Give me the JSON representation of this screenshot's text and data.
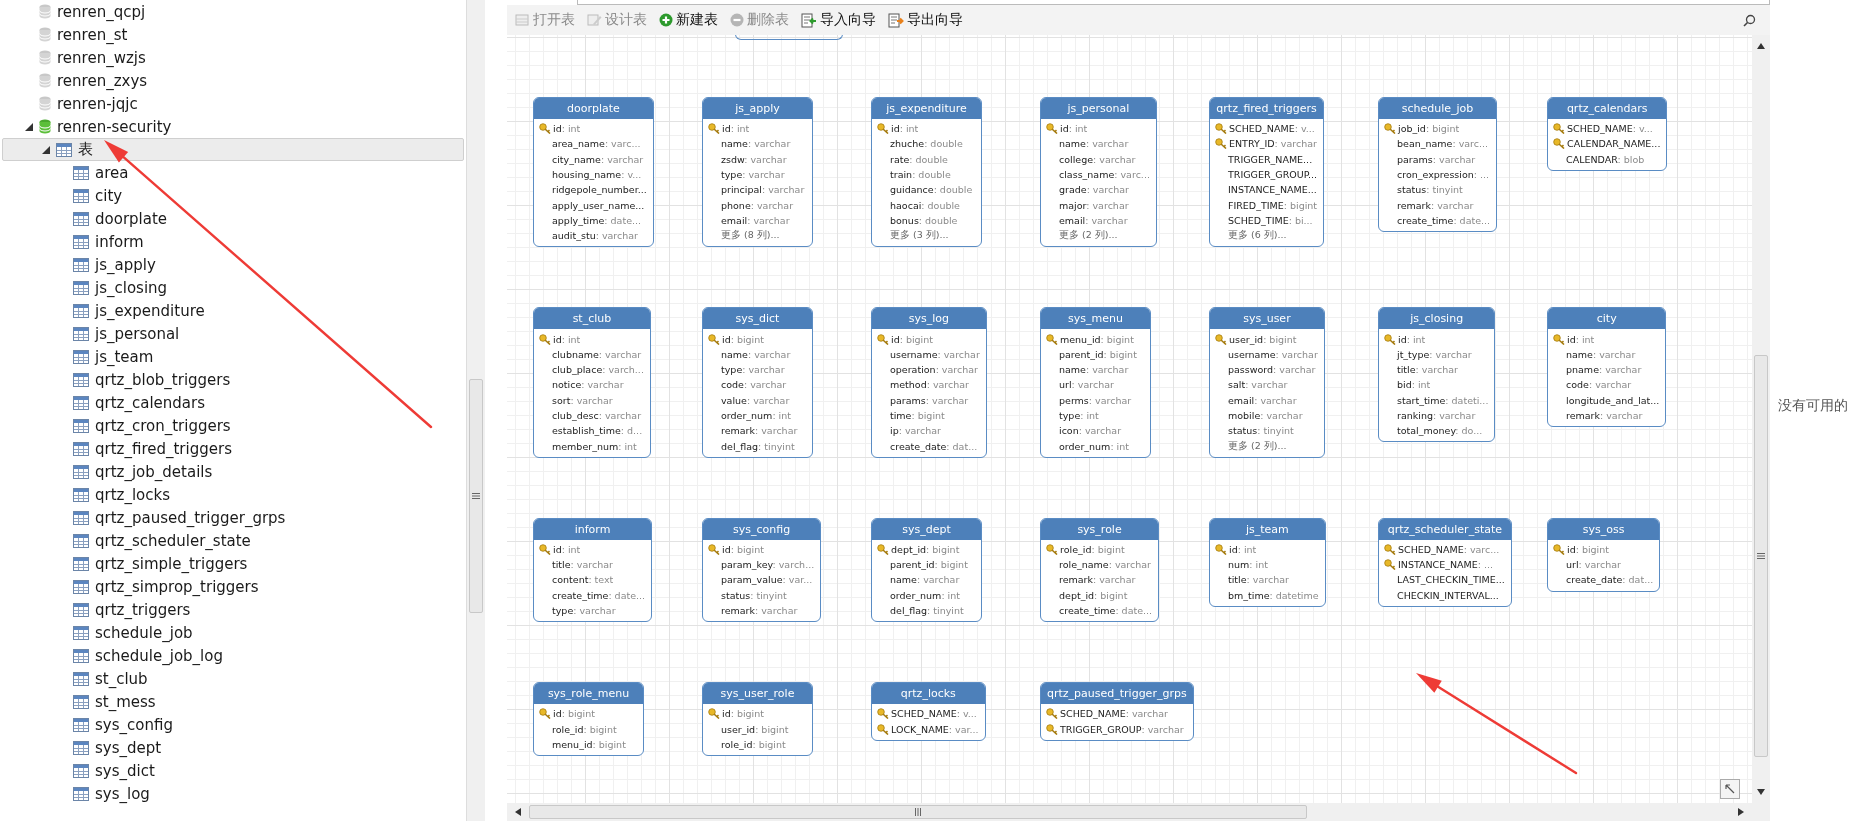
{
  "tree": [
    {
      "label": "renren_qcpj",
      "kind": "database",
      "selected": false
    },
    {
      "label": "renren_st",
      "kind": "database",
      "selected": false
    },
    {
      "label": "renren_wzjs",
      "kind": "database",
      "selected": false
    },
    {
      "label": "renren_zxys",
      "kind": "database",
      "selected": false
    },
    {
      "label": "renren-jqjc",
      "kind": "database",
      "selected": false
    },
    {
      "label": "renren-security",
      "kind": "database",
      "selected": false,
      "expanded": true,
      "children": [
        {
          "label": "表",
          "kind": "folder",
          "selected": true,
          "expanded": true,
          "children": [
            {
              "label": "area",
              "kind": "table",
              "selected": false
            },
            {
              "label": "city",
              "kind": "table",
              "selected": false
            },
            {
              "label": "doorplate",
              "kind": "table",
              "selected": false
            },
            {
              "label": "inform",
              "kind": "table",
              "selected": false
            },
            {
              "label": "js_apply",
              "kind": "table",
              "selected": false
            },
            {
              "label": "js_closing",
              "kind": "table",
              "selected": false
            },
            {
              "label": "js_expenditure",
              "kind": "table",
              "selected": false
            },
            {
              "label": "js_personal",
              "kind": "table",
              "selected": false
            },
            {
              "label": "js_team",
              "kind": "table",
              "selected": false
            },
            {
              "label": "qrtz_blob_triggers",
              "kind": "table",
              "selected": false
            },
            {
              "label": "qrtz_calendars",
              "kind": "table",
              "selected": false
            },
            {
              "label": "qrtz_cron_triggers",
              "kind": "table",
              "selected": false
            },
            {
              "label": "qrtz_fired_triggers",
              "kind": "table",
              "selected": false
            },
            {
              "label": "qrtz_job_details",
              "kind": "table",
              "selected": false
            },
            {
              "label": "qrtz_locks",
              "kind": "table",
              "selected": false
            },
            {
              "label": "qrtz_paused_trigger_grps",
              "kind": "table",
              "selected": false
            },
            {
              "label": "qrtz_scheduler_state",
              "kind": "table",
              "selected": false
            },
            {
              "label": "qrtz_simple_triggers",
              "kind": "table",
              "selected": false
            },
            {
              "label": "qrtz_simprop_triggers",
              "kind": "table",
              "selected": false
            },
            {
              "label": "qrtz_triggers",
              "kind": "table",
              "selected": false
            },
            {
              "label": "schedule_job",
              "kind": "table",
              "selected": false
            },
            {
              "label": "schedule_job_log",
              "kind": "table",
              "selected": false
            },
            {
              "label": "st_club",
              "kind": "table",
              "selected": false
            },
            {
              "label": "st_mess",
              "kind": "table",
              "selected": false
            },
            {
              "label": "sys_config",
              "kind": "table",
              "selected": false
            },
            {
              "label": "sys_dept",
              "kind": "table",
              "selected": false
            },
            {
              "label": "sys_dict",
              "kind": "table",
              "selected": false
            },
            {
              "label": "sys_log",
              "kind": "table",
              "selected": false
            }
          ]
        }
      ]
    }
  ],
  "toolbar": [
    {
      "label": "打开表",
      "kind": "open",
      "disabled": true
    },
    {
      "label": "设计表",
      "kind": "design",
      "disabled": true
    },
    {
      "label": "新建表",
      "kind": "new",
      "disabled": false
    },
    {
      "label": "删除表",
      "kind": "delete",
      "disabled": true
    },
    {
      "label": "导入向导",
      "kind": "import",
      "disabled": false
    },
    {
      "label": "导出向导",
      "kind": "export",
      "disabled": false
    }
  ],
  "diagram_rows": [
    [
      {
        "name": "doorplate",
        "fields": [
          {
            "kind": "key",
            "name": "id",
            "type": ": int"
          },
          {
            "kind": "column",
            "name": "area_name",
            "type": ": varc..."
          },
          {
            "kind": "column",
            "name": "city_name",
            "type": ": varchar"
          },
          {
            "kind": "column",
            "name": "housing_name",
            "type": ": v..."
          },
          {
            "kind": "column",
            "name": "ridgepole_number..."
          },
          {
            "kind": "column",
            "name": "apply_user_name..."
          },
          {
            "kind": "column",
            "name": "apply_time",
            "type": ": date..."
          },
          {
            "kind": "column",
            "name": "audit_stu",
            "type": ": varchar"
          }
        ]
      },
      {
        "name": "js_apply",
        "fields": [
          {
            "kind": "key",
            "name": "id",
            "type": ": int"
          },
          {
            "kind": "column",
            "name": "name",
            "type": ": varchar"
          },
          {
            "kind": "column",
            "name": "zsdw",
            "type": ": varchar"
          },
          {
            "kind": "column",
            "name": "type",
            "type": ": varchar"
          },
          {
            "kind": "column",
            "name": "principal",
            "type": ": varchar"
          },
          {
            "kind": "column",
            "name": "phone",
            "type": ": varchar"
          },
          {
            "kind": "column",
            "name": "email",
            "type": ": varchar"
          },
          {
            "kind": "more",
            "name": "更多 (8 列)..."
          }
        ]
      },
      {
        "name": "js_expenditure",
        "fields": [
          {
            "kind": "key",
            "name": "id",
            "type": ": int"
          },
          {
            "kind": "column",
            "name": "zhuche",
            "type": ": double"
          },
          {
            "kind": "column",
            "name": "rate",
            "type": ": double"
          },
          {
            "kind": "column",
            "name": "train",
            "type": ": double"
          },
          {
            "kind": "column",
            "name": "guidance",
            "type": ": double"
          },
          {
            "kind": "column",
            "name": "haocai",
            "type": ": double"
          },
          {
            "kind": "column",
            "name": "bonus",
            "type": ": double"
          },
          {
            "kind": "more",
            "name": "更多 (3 列)..."
          }
        ]
      },
      {
        "name": "js_personal",
        "fields": [
          {
            "kind": "key",
            "name": "id",
            "type": ": int"
          },
          {
            "kind": "column",
            "name": "name",
            "type": ": varchar"
          },
          {
            "kind": "column",
            "name": "college",
            "type": ": varchar"
          },
          {
            "kind": "column",
            "name": "class_name",
            "type": ": varc..."
          },
          {
            "kind": "column",
            "name": "grade",
            "type": ": varchar"
          },
          {
            "kind": "column",
            "name": "major",
            "type": ": varchar"
          },
          {
            "kind": "column",
            "name": "email",
            "type": ": varchar"
          },
          {
            "kind": "more",
            "name": "更多 (2 列)..."
          }
        ]
      },
      {
        "name": "qrtz_fired_triggers",
        "fields": [
          {
            "kind": "key",
            "name": "SCHED_NAME",
            "type": ": v..."
          },
          {
            "kind": "key",
            "name": "ENTRY_ID",
            "type": ": varchar"
          },
          {
            "kind": "column",
            "name": "TRIGGER_NAME..."
          },
          {
            "kind": "column",
            "name": "TRIGGER_GROUP..."
          },
          {
            "kind": "column",
            "name": "INSTANCE_NAME..."
          },
          {
            "kind": "column",
            "name": "FIRED_TIME",
            "type": ": bigint"
          },
          {
            "kind": "column",
            "name": "SCHED_TIME",
            "type": ": bi..."
          },
          {
            "kind": "more",
            "name": "更多 (6 列)..."
          }
        ]
      },
      {
        "name": "schedule_job",
        "fields": [
          {
            "kind": "key",
            "name": "job_id",
            "type": ": bigint"
          },
          {
            "kind": "column",
            "name": "bean_name",
            "type": ": varc..."
          },
          {
            "kind": "column",
            "name": "params",
            "type": ": varchar"
          },
          {
            "kind": "column",
            "name": "cron_expression",
            "type": ": ..."
          },
          {
            "kind": "column",
            "name": "status",
            "type": ": tinyint"
          },
          {
            "kind": "column",
            "name": "remark",
            "type": ": varchar"
          },
          {
            "kind": "column",
            "name": "create_time",
            "type": ": date..."
          }
        ]
      },
      {
        "name": "qrtz_calendars",
        "fields": [
          {
            "kind": "key",
            "name": "SCHED_NAME",
            "type": ": v..."
          },
          {
            "kind": "key",
            "name": "CALENDAR_NAME..."
          },
          {
            "kind": "column",
            "name": "CALENDAR",
            "type": ": blob"
          }
        ]
      }
    ],
    [
      {
        "name": "st_club",
        "fields": [
          {
            "kind": "key",
            "name": "id",
            "type": ": int"
          },
          {
            "kind": "column",
            "name": "clubname",
            "type": ": varchar"
          },
          {
            "kind": "column",
            "name": "club_place",
            "type": ": varch..."
          },
          {
            "kind": "column",
            "name": "notice",
            "type": ": varchar"
          },
          {
            "kind": "column",
            "name": "sort",
            "type": ": varchar"
          },
          {
            "kind": "column",
            "name": "club_desc",
            "type": ": varchar"
          },
          {
            "kind": "column",
            "name": "establish_time",
            "type": ": d..."
          },
          {
            "kind": "column",
            "name": "member_num",
            "type": ": int"
          }
        ]
      },
      {
        "name": "sys_dict",
        "fields": [
          {
            "kind": "key",
            "name": "id",
            "type": ": bigint"
          },
          {
            "kind": "column",
            "name": "name",
            "type": ": varchar"
          },
          {
            "kind": "column",
            "name": "type",
            "type": ": varchar"
          },
          {
            "kind": "column",
            "name": "code",
            "type": ": varchar"
          },
          {
            "kind": "column",
            "name": "value",
            "type": ": varchar"
          },
          {
            "kind": "column",
            "name": "order_num",
            "type": ": int"
          },
          {
            "kind": "column",
            "name": "remark",
            "type": ": varchar"
          },
          {
            "kind": "column",
            "name": "del_flag",
            "type": ": tinyint"
          }
        ]
      },
      {
        "name": "sys_log",
        "fields": [
          {
            "kind": "key",
            "name": "id",
            "type": ": bigint"
          },
          {
            "kind": "column",
            "name": "username",
            "type": ": varchar"
          },
          {
            "kind": "column",
            "name": "operation",
            "type": ": varchar"
          },
          {
            "kind": "column",
            "name": "method",
            "type": ": varchar"
          },
          {
            "kind": "column",
            "name": "params",
            "type": ": varchar"
          },
          {
            "kind": "column",
            "name": "time",
            "type": ": bigint"
          },
          {
            "kind": "column",
            "name": "ip",
            "type": ": varchar"
          },
          {
            "kind": "column",
            "name": "create_date",
            "type": ": dat..."
          }
        ]
      },
      {
        "name": "sys_menu",
        "fields": [
          {
            "kind": "key",
            "name": "menu_id",
            "type": ": bigint"
          },
          {
            "kind": "column",
            "name": "parent_id",
            "type": ": bigint"
          },
          {
            "kind": "column",
            "name": "name",
            "type": ": varchar"
          },
          {
            "kind": "column",
            "name": "url",
            "type": ": varchar"
          },
          {
            "kind": "column",
            "name": "perms",
            "type": ": varchar"
          },
          {
            "kind": "column",
            "name": "type",
            "type": ": int"
          },
          {
            "kind": "column",
            "name": "icon",
            "type": ": varchar"
          },
          {
            "kind": "column",
            "name": "order_num",
            "type": ": int"
          }
        ]
      },
      {
        "name": "sys_user",
        "fields": [
          {
            "kind": "key",
            "name": "user_id",
            "type": ": bigint"
          },
          {
            "kind": "column",
            "name": "username",
            "type": ": varchar"
          },
          {
            "kind": "column",
            "name": "password",
            "type": ": varchar"
          },
          {
            "kind": "column",
            "name": "salt",
            "type": ": varchar"
          },
          {
            "kind": "column",
            "name": "email",
            "type": ": varchar"
          },
          {
            "kind": "column",
            "name": "mobile",
            "type": ": varchar"
          },
          {
            "kind": "column",
            "name": "status",
            "type": ": tinyint"
          },
          {
            "kind": "more",
            "name": "更多 (2 列)..."
          }
        ]
      },
      {
        "name": "js_closing",
        "fields": [
          {
            "kind": "key",
            "name": "id",
            "type": ": int"
          },
          {
            "kind": "column",
            "name": "jt_type",
            "type": ": varchar"
          },
          {
            "kind": "column",
            "name": "title",
            "type": ": varchar"
          },
          {
            "kind": "column",
            "name": "bid",
            "type": ": int"
          },
          {
            "kind": "column",
            "name": "start_time",
            "type": ": dateti..."
          },
          {
            "kind": "column",
            "name": "ranking",
            "type": ": varchar"
          },
          {
            "kind": "column",
            "name": "total_money",
            "type": ": do..."
          }
        ]
      },
      {
        "name": "city",
        "fields": [
          {
            "kind": "key",
            "name": "id",
            "type": ": int"
          },
          {
            "kind": "column",
            "name": "name",
            "type": ": varchar"
          },
          {
            "kind": "column",
            "name": "pname",
            "type": ": varchar"
          },
          {
            "kind": "column",
            "name": "code",
            "type": ": varchar"
          },
          {
            "kind": "column",
            "name": "longitude_and_lat..."
          },
          {
            "kind": "column",
            "name": "remark",
            "type": ": varchar"
          }
        ]
      }
    ],
    [
      {
        "name": "inform",
        "fields": [
          {
            "kind": "key",
            "name": "id",
            "type": ": int"
          },
          {
            "kind": "column",
            "name": "title",
            "type": ": varchar"
          },
          {
            "kind": "column",
            "name": "content",
            "type": ": text"
          },
          {
            "kind": "column",
            "name": "create_time",
            "type": ": date..."
          },
          {
            "kind": "column",
            "name": "type",
            "type": ": varchar"
          }
        ]
      },
      {
        "name": "sys_config",
        "fields": [
          {
            "kind": "key",
            "name": "id",
            "type": ": bigint"
          },
          {
            "kind": "column",
            "name": "param_key",
            "type": ": varch..."
          },
          {
            "kind": "column",
            "name": "param_value",
            "type": ": var..."
          },
          {
            "kind": "column",
            "name": "status",
            "type": ": tinyint"
          },
          {
            "kind": "column",
            "name": "remark",
            "type": ": varchar"
          }
        ]
      },
      {
        "name": "sys_dept",
        "fields": [
          {
            "kind": "key",
            "name": "dept_id",
            "type": ": bigint"
          },
          {
            "kind": "column",
            "name": "parent_id",
            "type": ": bigint"
          },
          {
            "kind": "column",
            "name": "name",
            "type": ": varchar"
          },
          {
            "kind": "column",
            "name": "order_num",
            "type": ": int"
          },
          {
            "kind": "column",
            "name": "del_flag",
            "type": ": tinyint"
          }
        ]
      },
      {
        "name": "sys_role",
        "fields": [
          {
            "kind": "key",
            "name": "role_id",
            "type": ": bigint"
          },
          {
            "kind": "column",
            "name": "role_name",
            "type": ": varchar"
          },
          {
            "kind": "column",
            "name": "remark",
            "type": ": varchar"
          },
          {
            "kind": "column",
            "name": "dept_id",
            "type": ": bigint"
          },
          {
            "kind": "column",
            "name": "create_time",
            "type": ": date..."
          }
        ]
      },
      {
        "name": "js_team",
        "fields": [
          {
            "kind": "key",
            "name": "id",
            "type": ": int"
          },
          {
            "kind": "column",
            "name": "num",
            "type": ": int"
          },
          {
            "kind": "column",
            "name": "title",
            "type": ": varchar"
          },
          {
            "kind": "column",
            "name": "bm_time",
            "type": ": datetime"
          }
        ]
      },
      {
        "name": "qrtz_scheduler_state",
        "fields": [
          {
            "kind": "key",
            "name": "SCHED_NAME",
            "type": ": varc..."
          },
          {
            "kind": "key",
            "name": "INSTANCE_NAME",
            "type": ": ..."
          },
          {
            "kind": "column",
            "name": "LAST_CHECKIN_TIME..."
          },
          {
            "kind": "column",
            "name": "CHECKIN_INTERVAL..."
          }
        ]
      },
      {
        "name": "sys_oss",
        "fields": [
          {
            "kind": "key",
            "name": "id",
            "type": ": bigint"
          },
          {
            "kind": "column",
            "name": "url",
            "type": ": varchar"
          },
          {
            "kind": "column",
            "name": "create_date",
            "type": ": dat..."
          }
        ]
      }
    ],
    [
      {
        "name": "sys_role_menu",
        "fields": [
          {
            "kind": "key",
            "name": "id",
            "type": ": bigint"
          },
          {
            "kind": "column",
            "name": "role_id",
            "type": ": bigint"
          },
          {
            "kind": "column",
            "name": "menu_id",
            "type": ": bigint"
          }
        ]
      },
      {
        "name": "sys_user_role",
        "fields": [
          {
            "kind": "key",
            "name": "id",
            "type": ": bigint"
          },
          {
            "kind": "column",
            "name": "user_id",
            "type": ": bigint"
          },
          {
            "kind": "column",
            "name": "role_id",
            "type": ": bigint"
          }
        ]
      },
      {
        "name": "qrtz_locks",
        "fields": [
          {
            "kind": "key",
            "name": "SCHED_NAME",
            "type": ": v..."
          },
          {
            "kind": "key",
            "name": "LOCK_NAME",
            "type": ": var..."
          }
        ]
      },
      {
        "name": "qrtz_paused_trigger_grps",
        "fields": [
          {
            "kind": "key",
            "name": "SCHED_NAME",
            "type": ": varchar"
          },
          {
            "kind": "key",
            "name": "TRIGGER_GROUP",
            "type": ": varchar"
          }
        ]
      }
    ]
  ],
  "side_panel": {
    "message": "没有可用的"
  },
  "annotations": [
    {
      "kind": "arrow"
    },
    {
      "kind": "arrow"
    }
  ]
}
